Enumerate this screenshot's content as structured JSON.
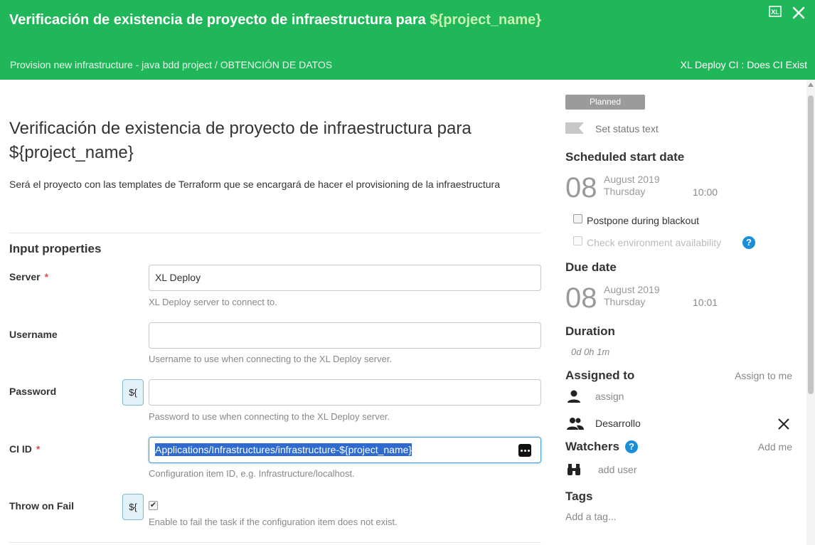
{
  "header": {
    "title_prefix": "Verificación de existencia de proyecto de infraestructura para",
    "title_var": "${project_name}",
    "breadcrumb": "Provision new infrastructure - java bdd project / OBTENCIÓN DE DATOS",
    "task_type": "XL Deploy CI : Does CI Exist",
    "icons": [
      "xl-deploy-icon",
      "close-icon"
    ]
  },
  "main": {
    "title": "Verificación de existencia de proyecto de infraestructura para ${project_name}",
    "description": "Será el proyecto con las templates de Terraform que se encargará de hacer el provisioning de la infraestructura",
    "section_title": "Input properties",
    "variable_button": "${",
    "properties": [
      {
        "label": "Server",
        "required": true,
        "value": "XL Deploy",
        "help": "XL Deploy server to connect to."
      },
      {
        "label": "Username",
        "required": false,
        "value": "",
        "help": "Username to use when connecting to the XL Deploy server."
      },
      {
        "label": "Password",
        "required": false,
        "value": "",
        "help": "Password to use when connecting to the XL Deploy server."
      },
      {
        "label": "CI ID",
        "required": true,
        "value": "Applications/Infrastructures/infrastructure-${project_name}",
        "help": "Configuration item ID, e.g. Infrastructure/localhost."
      },
      {
        "label": "Throw on Fail",
        "required": false,
        "checked": true,
        "help": "Enable to fail the task if the configuration item does not exist."
      }
    ]
  },
  "side": {
    "status": "Planned",
    "status_placeholder": "Set status text",
    "scheduled": {
      "heading": "Scheduled start date",
      "day": "08",
      "month": "August 2019",
      "weekday": "Thursday",
      "time": "10:00"
    },
    "postpone_label": "Postpone during blackout",
    "check_env_label": "Check environment availability",
    "due": {
      "heading": "Due date",
      "day": "08",
      "month": "August 2019",
      "weekday": "Thursday",
      "time": "10:01"
    },
    "duration_heading": "Duration",
    "duration": "0d 0h 1m",
    "assigned_heading": "Assigned to",
    "assign_to_me": "Assign to me",
    "assign_placeholder": "assign",
    "team": "Desarrollo",
    "watchers_heading": "Watchers",
    "add_me": "Add me",
    "add_user": "add user",
    "tags_heading": "Tags",
    "tag_placeholder": "Add a tag...",
    "help_glyph": "?"
  },
  "colors": {
    "header_bg": "#20b75a",
    "accent_blue": "#1a8fd9",
    "status_badge": "#9b9b9b",
    "required": "#d9534f"
  }
}
